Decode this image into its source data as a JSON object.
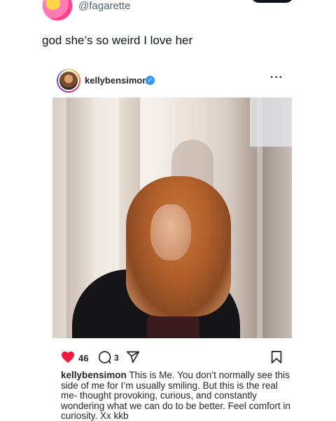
{
  "tweet": {
    "handle": "@fagarette",
    "text": "god she’s so weird I love her"
  },
  "instagram": {
    "username": "kellybensimon",
    "verified": true,
    "more_icon": "more-dots-icon",
    "likes": "46",
    "comments": "3",
    "caption_user": "kellybensimon",
    "caption_text": "This is Me. You don’t normally see this side of me for I’m usually smiling. But this is the real me- thought provoking, curious, and constantly wondering what we can do to be better. Feel comfort in curiosity. Xx kkb",
    "colors": {
      "heart": "#ed1c3a",
      "verified": "#3897f0"
    }
  }
}
